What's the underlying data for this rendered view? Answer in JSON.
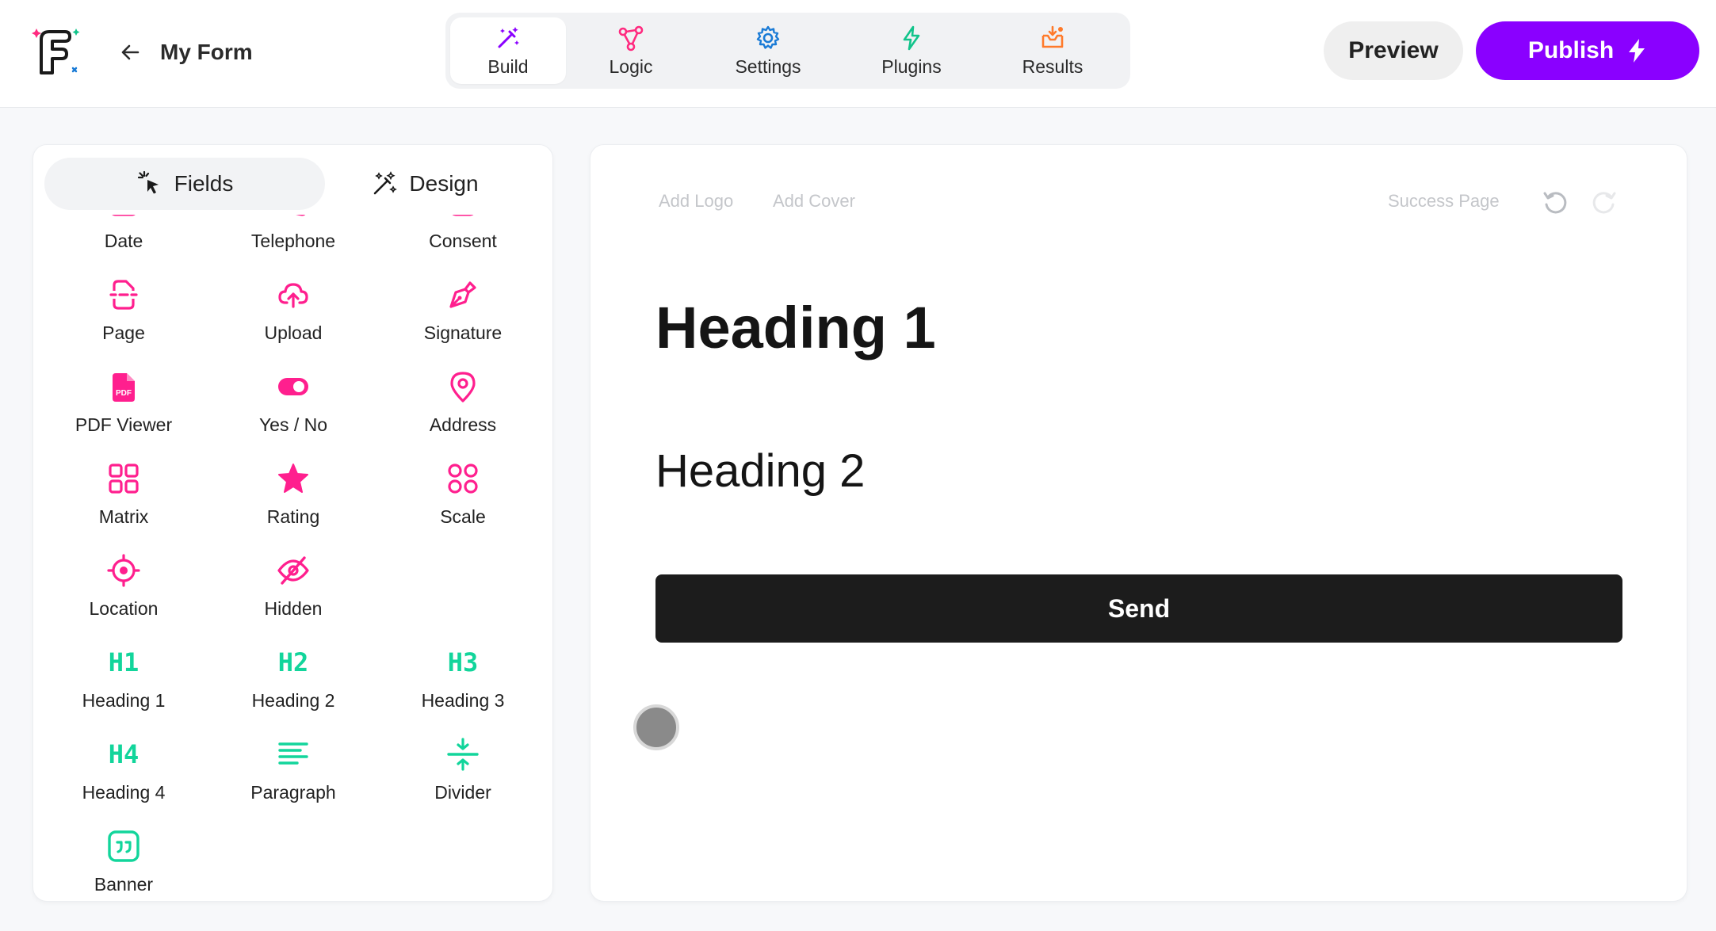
{
  "header": {
    "form_title": "My Form",
    "tabs": [
      {
        "label": "Build",
        "icon": "magic-wand-icon",
        "color": "#8a00ff",
        "active": true
      },
      {
        "label": "Logic",
        "icon": "logic-nodes-icon",
        "color": "#ff2a7f"
      },
      {
        "label": "Settings",
        "icon": "gear-icon",
        "color": "#1a7bd6"
      },
      {
        "label": "Plugins",
        "icon": "lightning-icon",
        "color": "#12c48b"
      },
      {
        "label": "Results",
        "icon": "inbox-icon",
        "color": "#ff7a2a"
      }
    ],
    "preview_label": "Preview",
    "publish_label": "Publish"
  },
  "left_panel": {
    "tabs": {
      "fields": "Fields",
      "design": "Design"
    },
    "fields": [
      [
        "Date",
        "Telephone",
        "Consent"
      ],
      [
        "Page",
        "Upload",
        "Signature"
      ],
      [
        "PDF Viewer",
        "Yes / No",
        "Address"
      ],
      [
        "Matrix",
        "Rating",
        "Scale"
      ],
      [
        "Location",
        "Hidden",
        ""
      ],
      [
        "Heading 1",
        "Heading 2",
        "Heading 3"
      ],
      [
        "Heading 4",
        "Paragraph",
        "Divider"
      ],
      [
        "Banner",
        "",
        ""
      ]
    ],
    "heading_icons": {
      "h1": "H1",
      "h2": "H2",
      "h3": "H3",
      "h4": "H4"
    },
    "pdf_icon_text": "PDF"
  },
  "canvas": {
    "add_logo": "Add Logo",
    "add_cover": "Add Cover",
    "success_page": "Success Page",
    "heading1": "Heading 1",
    "heading2": "Heading 2",
    "send_label": "Send"
  },
  "colors": {
    "accent": "#8a00ff",
    "field_icon_pink": "#ff1f8e",
    "field_icon_green": "#12d59b"
  }
}
